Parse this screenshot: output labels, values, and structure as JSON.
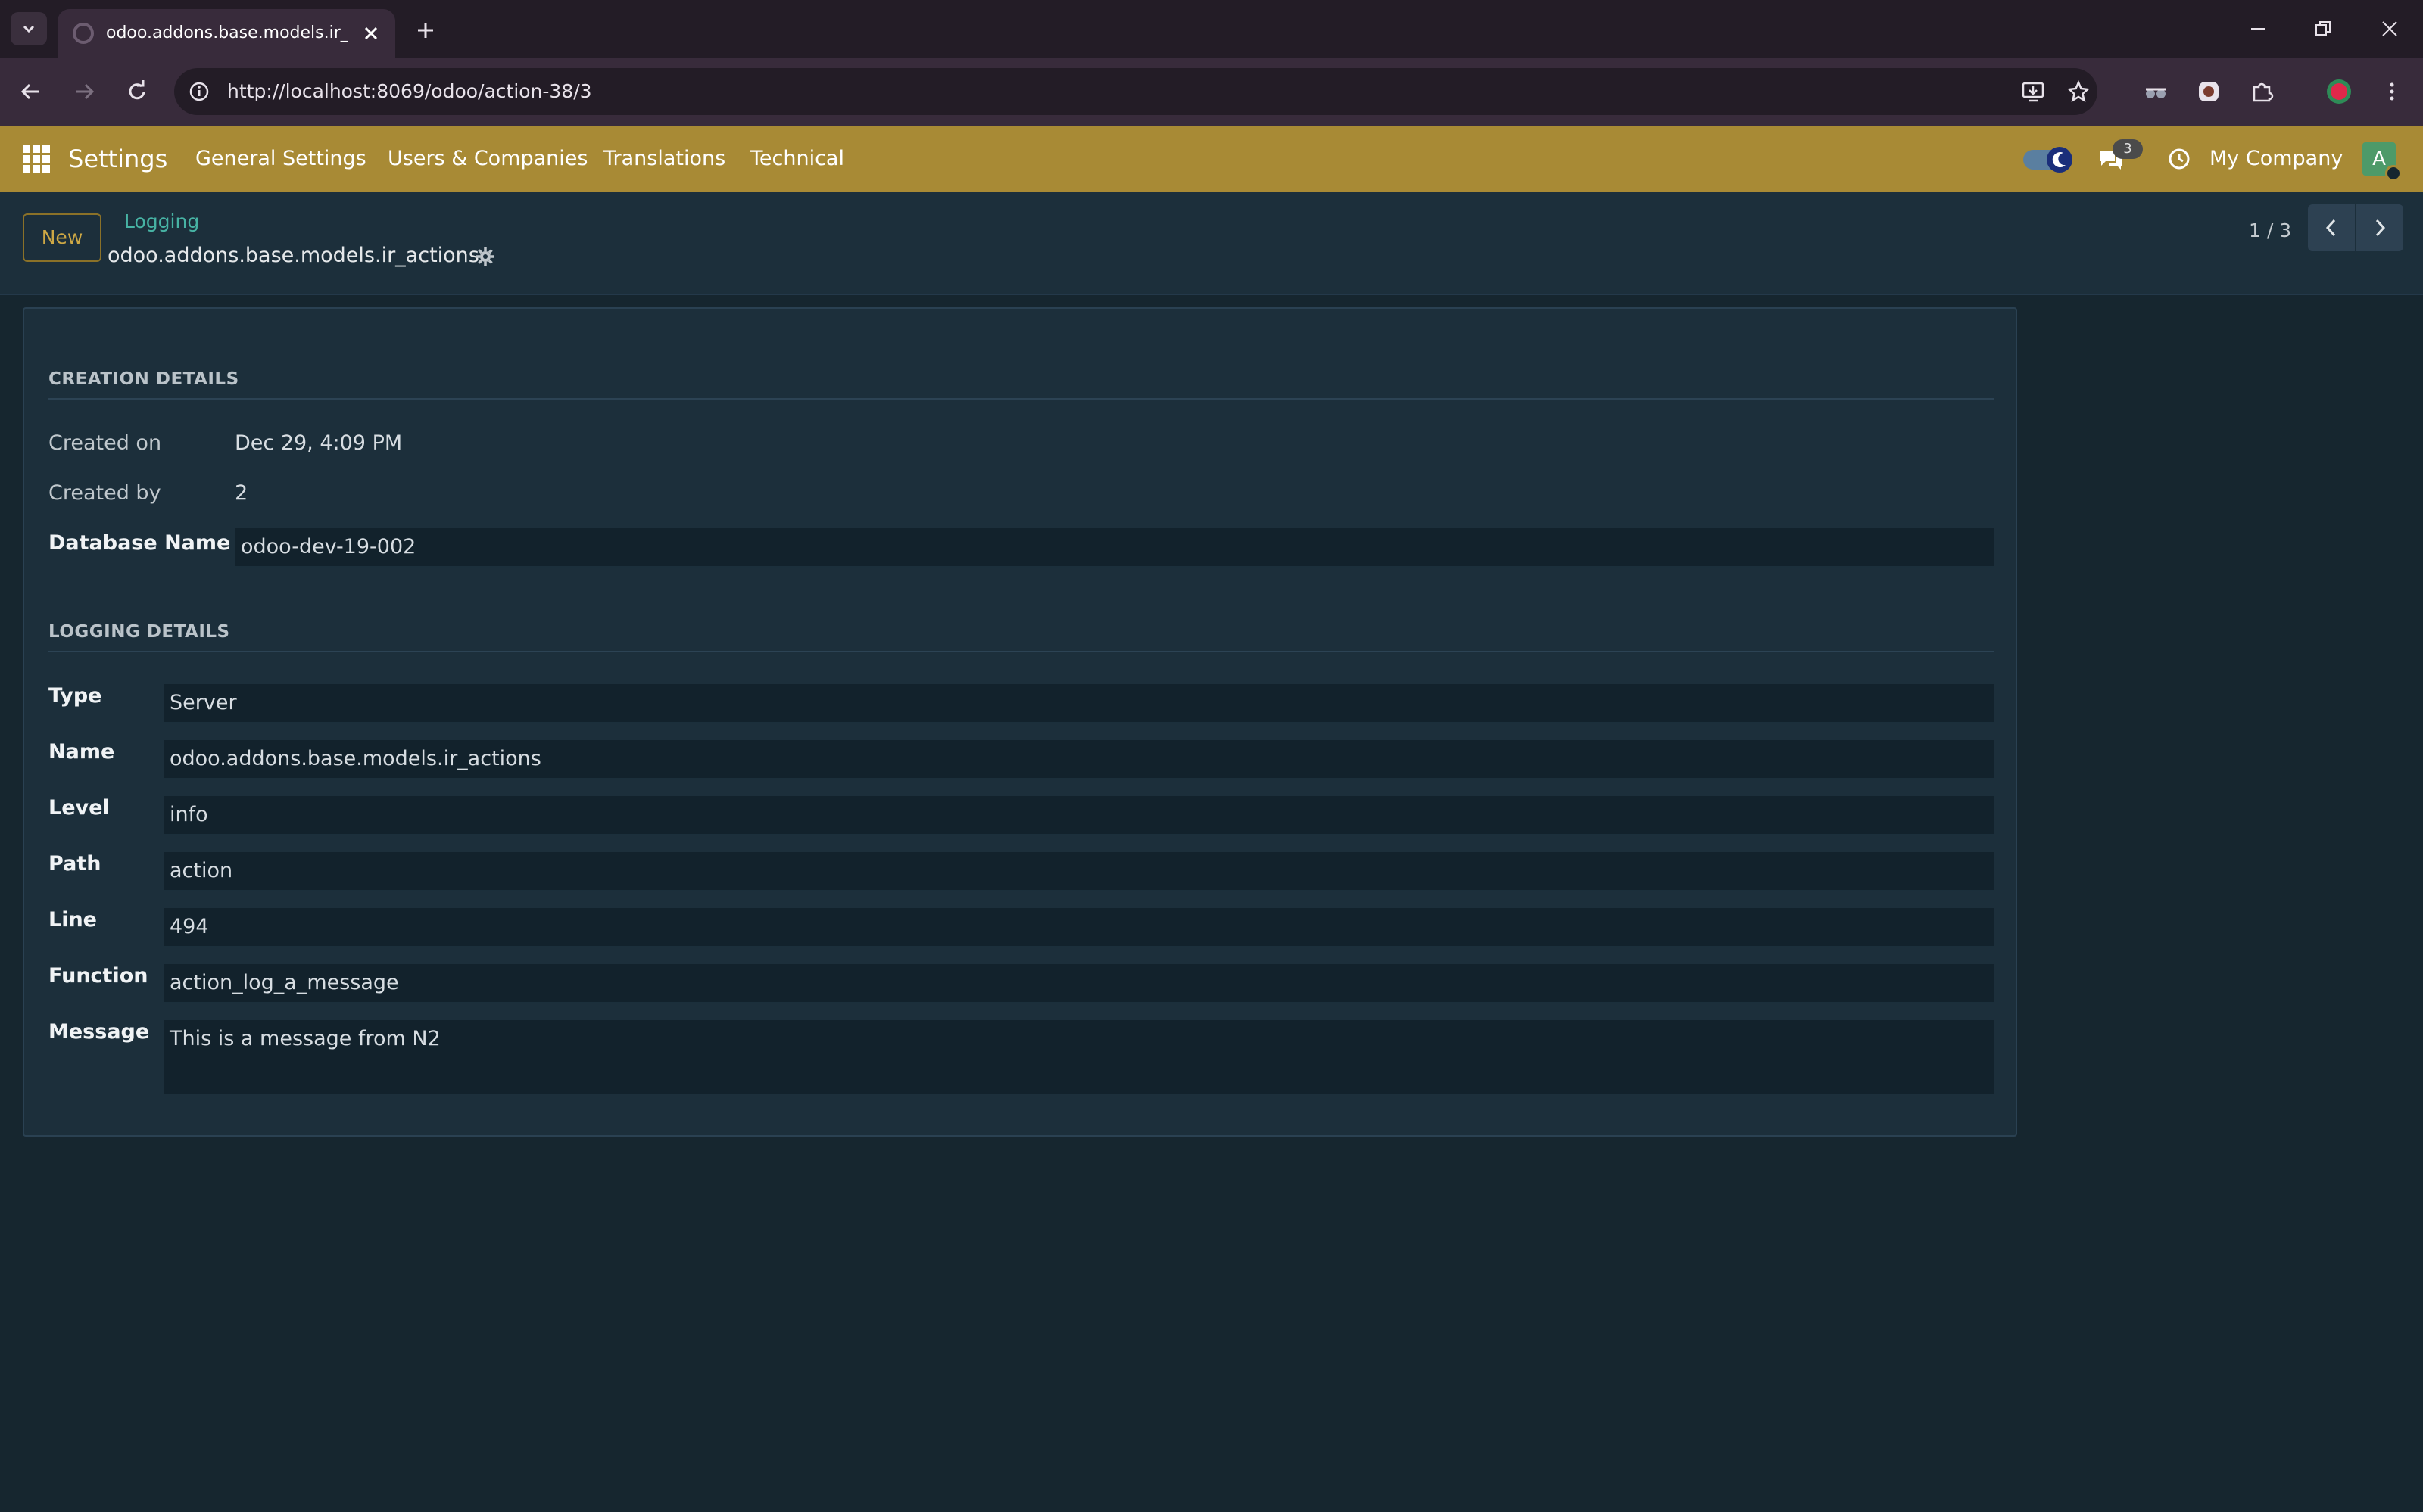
{
  "browser": {
    "tab_title": "odoo.addons.base.models.ir_actio",
    "url": "http://localhost:8069/odoo/action-38/3"
  },
  "navbar": {
    "brand": "Settings",
    "menu": [
      "General Settings",
      "Users & Companies",
      "Translations",
      "Technical"
    ],
    "chat_badge": "3",
    "company": "My Company",
    "avatar_initial": "A",
    "color": "#a88a35"
  },
  "control_panel": {
    "new_label": "New",
    "breadcrumb": "Logging",
    "record_title": "odoo.addons.base.models.ir_actions",
    "pager": "1 / 3"
  },
  "creation": {
    "title": "CREATION DETAILS",
    "created_on_label": "Created on",
    "created_on": "Dec 29, 4:09 PM",
    "created_by_label": "Created by",
    "created_by": "2",
    "dbname_label": "Database Name",
    "dbname": "odoo-dev-19-002"
  },
  "logging": {
    "title": "LOGGING DETAILS",
    "fields": [
      {
        "label": "Type",
        "value": "Server"
      },
      {
        "label": "Name",
        "value": "odoo.addons.base.models.ir_actions"
      },
      {
        "label": "Level",
        "value": "info"
      },
      {
        "label": "Path",
        "value": "action"
      },
      {
        "label": "Line",
        "value": "494"
      },
      {
        "label": "Function",
        "value": "action_log_a_message"
      },
      {
        "label": "Message",
        "value": "This is a message from N2"
      }
    ]
  }
}
